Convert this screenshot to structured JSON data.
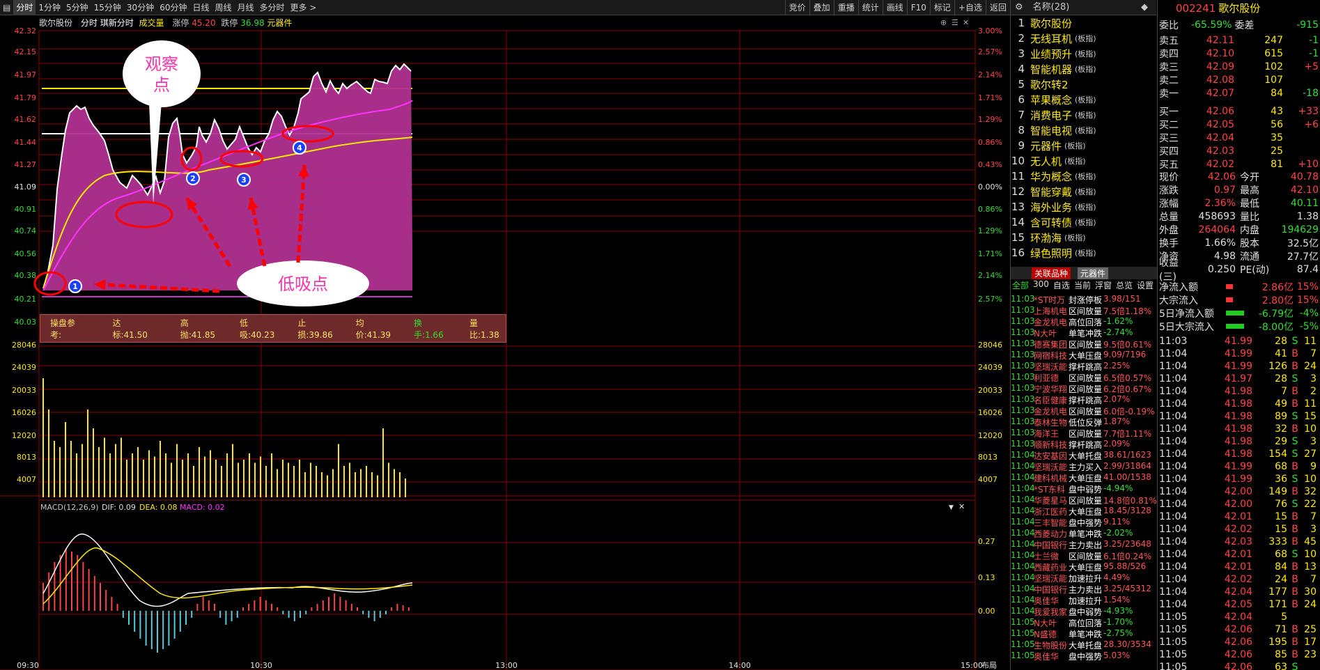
{
  "toolbar": {
    "tabs": [
      "分时",
      "1分钟",
      "5分钟",
      "15分钟",
      "30分钟",
      "60分钟",
      "日线",
      "周线",
      "月线",
      "多分时",
      "更多 >"
    ],
    "right": [
      "竞价",
      "叠加",
      "重播",
      "统计",
      "画线",
      "F10",
      "标记",
      "+自选",
      "返回"
    ]
  },
  "info": {
    "stock": "歌尔股份",
    "mode": "分时",
    "sub": "琪新分时",
    "vol": "成交量",
    "zt_label": "涨停",
    "zt": "45.20",
    "dt_label": "跌停",
    "dt": "36.98",
    "sector": "元器件"
  },
  "price_axis": [
    "42.32",
    "42.15",
    "41.97",
    "41.79",
    "41.62",
    "41.44",
    "41.27",
    "41.09",
    "40.91",
    "40.74",
    "40.56",
    "40.38",
    "40.21",
    "40.03"
  ],
  "pct_axis": [
    "3.00%",
    "2.57%",
    "2.14%",
    "1.71%",
    "1.29%",
    "0.86%",
    "0.43%",
    "0.00%",
    "0.86%",
    "1.29%",
    "1.71%",
    "2.14%",
    "2.57%"
  ],
  "vol_axis": [
    "28046",
    "24039",
    "20033",
    "16026",
    "12020",
    "8013",
    "4007"
  ],
  "macd": {
    "label": "MACD(12,26,9)",
    "dif": "DIF: 0.09",
    "dea": "DEA: 0.08",
    "macd": "MACD: 0.02",
    "axis": [
      "0.27",
      "0.13",
      "0.00"
    ]
  },
  "time_axis": [
    "09:30",
    "10:30",
    "13:00",
    "14:00",
    "15:00"
  ],
  "layout_btn": "布局",
  "annot": {
    "observe": "观察点",
    "buy": "低吸点",
    "n1": "1",
    "n2": "2",
    "n3": "3",
    "n4": "4"
  },
  "ops": {
    "title": "操盘参考:",
    "target": "达标:41.50",
    "high": "高抛:41.85",
    "low": "低吸:40.23",
    "stop": "止损:39.86",
    "avg": "均价:41.39",
    "turn": "换手:1.66",
    "ratio": "量比:1.38"
  },
  "blocks": {
    "header": "名称(28)",
    "items": [
      {
        "n": "1",
        "t": "歌尔股份",
        "s": ""
      },
      {
        "n": "2",
        "t": "无线耳机",
        "s": "(板指)"
      },
      {
        "n": "3",
        "t": "业绩预升",
        "s": "(板指)"
      },
      {
        "n": "4",
        "t": "智能机器",
        "s": "(板指)"
      },
      {
        "n": "5",
        "t": "歌尔转2",
        "s": ""
      },
      {
        "n": "6",
        "t": "苹果概念",
        "s": "(板指)"
      },
      {
        "n": "7",
        "t": "消费电子",
        "s": "(板指)"
      },
      {
        "n": "8",
        "t": "智能电视",
        "s": "(板指)"
      },
      {
        "n": "9",
        "t": "元器件",
        "s": "(板指)"
      },
      {
        "n": "10",
        "t": "无人机",
        "s": "(板指)"
      },
      {
        "n": "11",
        "t": "华为概念",
        "s": "(板指)"
      },
      {
        "n": "12",
        "t": "智能穿戴",
        "s": "(板指)"
      },
      {
        "n": "13",
        "t": "海外业务",
        "s": "(板指)"
      },
      {
        "n": "14",
        "t": "含可转债",
        "s": "(板指)"
      },
      {
        "n": "15",
        "t": "环渤海",
        "s": "(板指)"
      },
      {
        "n": "16",
        "t": "绿色照明",
        "s": "(板指)"
      }
    ],
    "tab1": "关联品种",
    "tab2": "元器件",
    "sub": [
      "全部",
      "300",
      "自选",
      "当前",
      "浮窗",
      "总览",
      "设置"
    ]
  },
  "alerts": [
    [
      "11:03",
      "*ST时万",
      "封涨停板",
      "3.98/151"
    ],
    [
      "11:03",
      "上海机电",
      "区间放量",
      "7.5倍1.18%"
    ],
    [
      "11:03",
      "金龙机电",
      "高位回落",
      "-1.62%"
    ],
    [
      "11:03",
      "N大叶",
      "单笔冲跌",
      "-2.74%"
    ],
    [
      "11:03",
      "德赛集团",
      "区间放量",
      "9.5倍0.61%"
    ],
    [
      "11:03",
      "网宿科技",
      "大单压盘",
      "9.09/7196"
    ],
    [
      "11:03",
      "坚瑞沃能",
      "撑杆跳高",
      "2.25%"
    ],
    [
      "11:03",
      "利亚德",
      "区间放量",
      "6.5倍0.57%"
    ],
    [
      "11:03",
      "宁波华翔",
      "区间放量",
      "6.2倍0.67%"
    ],
    [
      "11:03",
      "名臣健康",
      "撑杆跳高",
      "2.07%"
    ],
    [
      "11:03",
      "金龙机电",
      "区间放量",
      "6.0倍-0.19%"
    ],
    [
      "11:03",
      "泰林生物",
      "低位反弹",
      "1.87%"
    ],
    [
      "11:03",
      "海洋王",
      "区间放量",
      "7.7倍1.11%"
    ],
    [
      "11:03",
      "顺新科技",
      "撑杆跳高",
      "2.09%"
    ],
    [
      "11:04",
      "达安基因",
      "大单托盘",
      "38.61/1623"
    ],
    [
      "11:04",
      "坚瑞沃能",
      "主力买入",
      "2.99/31864"
    ],
    [
      "11:04",
      "建科机械",
      "大单压盘",
      "41.00/1538"
    ],
    [
      "11:04",
      "*ST东科",
      "盘中弱势",
      "-4.94%"
    ],
    [
      "11:04",
      "华菱星马",
      "区间放量",
      "14.8倍0.81%"
    ],
    [
      "11:04",
      "浙江医药",
      "大单压盘",
      "18.45/3128"
    ],
    [
      "11:04",
      "三丰智能",
      "盘中强势",
      "9.11%"
    ],
    [
      "11:04",
      "西菱动力",
      "单笔冲跌",
      "-2.02%"
    ],
    [
      "11:04",
      "中国银行",
      "主力卖出",
      "3.25/23648"
    ],
    [
      "11:04",
      "士兰微",
      "区间放量",
      "6.1倍0.24%"
    ],
    [
      "11:04",
      "西藏药业",
      "大单压盘",
      "95.88/526"
    ],
    [
      "11:04",
      "坚瑞沃能",
      "加速拉升",
      "4.49%"
    ],
    [
      "11:04",
      "中国银行",
      "主力卖出",
      "3.25/45312"
    ],
    [
      "11:04",
      "奥佳华",
      "加速拉升",
      "1.54%"
    ],
    [
      "11:04",
      "我爱我家",
      "盘中弱势",
      "-4.93%"
    ],
    [
      "11:05",
      "N大叶",
      "高位回落",
      "-1.70%"
    ],
    [
      "11:05",
      "N盛德",
      "单笔冲跌",
      "-2.75%"
    ],
    [
      "11:05",
      "生物股份",
      "大单托盘",
      "28.30/3534"
    ],
    [
      "11:05",
      "奥佳华",
      "盘中强势",
      "5.03%"
    ]
  ],
  "quote": {
    "code": "002241",
    "name": "歌尔股份",
    "webi_l": "委比",
    "webi": "-65.59%",
    "wecha_l": "委差",
    "wecha": "-915",
    "sell": [
      [
        "卖五",
        "42.11",
        "247",
        "-1"
      ],
      [
        "卖四",
        "42.10",
        "615",
        "-1"
      ],
      [
        "卖三",
        "42.09",
        "102",
        "+5"
      ],
      [
        "卖二",
        "42.08",
        "107",
        ""
      ],
      [
        "卖一",
        "42.07",
        "84",
        "-18"
      ]
    ],
    "buy": [
      [
        "买一",
        "42.06",
        "43",
        "+33"
      ],
      [
        "买二",
        "42.05",
        "56",
        "+6"
      ],
      [
        "买三",
        "42.04",
        "35",
        ""
      ],
      [
        "买四",
        "42.03",
        "25",
        ""
      ],
      [
        "买五",
        "42.02",
        "81",
        "+10"
      ]
    ],
    "stats": [
      [
        "现价",
        "42.06",
        "今开",
        "40.78"
      ],
      [
        "涨跌",
        "0.97",
        "最高",
        "42.10"
      ],
      [
        "涨幅",
        "2.36%",
        "最低",
        "40.11"
      ],
      [
        "总量",
        "458693",
        "量比",
        "1.38"
      ],
      [
        "外盘",
        "264064",
        "内盘",
        "194629"
      ],
      [
        "换手",
        "1.66%",
        "股本",
        "32.5亿"
      ],
      [
        "净资",
        "4.98",
        "流通",
        "27.7亿"
      ],
      [
        "收益(三)",
        "0.250",
        "PE(动)",
        "87.4"
      ]
    ],
    "flows": [
      [
        "净流入额",
        "2.86亿",
        "15%"
      ],
      [
        "大宗流入",
        "2.80亿",
        "15%"
      ],
      [
        "5日净流入额",
        "-6.79亿",
        "-4%"
      ],
      [
        "5日大宗流入",
        "-8.00亿",
        "-5%"
      ]
    ],
    "ticks": [
      [
        "11:03",
        "41.99",
        "28",
        "S",
        "11"
      ],
      [
        "11:04",
        "41.99",
        "41",
        "B",
        "7"
      ],
      [
        "11:04",
        "41.99",
        "126",
        "B",
        "24"
      ],
      [
        "11:04",
        "41.97",
        "28",
        "S",
        "3"
      ],
      [
        "11:04",
        "41.98",
        "7",
        "B",
        "2"
      ],
      [
        "11:04",
        "41.98",
        "49",
        "B",
        "11"
      ],
      [
        "11:04",
        "41.98",
        "89",
        "S",
        "15"
      ],
      [
        "11:04",
        "41.98",
        "32",
        "B",
        "10"
      ],
      [
        "11:04",
        "41.98",
        "29",
        "S",
        "3"
      ],
      [
        "11:04",
        "41.98",
        "154",
        "S",
        "27"
      ],
      [
        "11:04",
        "41.99",
        "68",
        "B",
        "9"
      ],
      [
        "11:04",
        "41.99",
        "36",
        "S",
        "10"
      ],
      [
        "11:04",
        "42.00",
        "149",
        "B",
        "32"
      ],
      [
        "11:04",
        "42.00",
        "76",
        "S",
        "22"
      ],
      [
        "11:04",
        "42.01",
        "15",
        "B",
        "7"
      ],
      [
        "11:04",
        "42.02",
        "15",
        "B",
        "3"
      ],
      [
        "11:04",
        "42.03",
        "333",
        "B",
        "45"
      ],
      [
        "11:04",
        "42.01",
        "68",
        "S",
        "10"
      ],
      [
        "11:04",
        "42.01",
        "84",
        "B",
        "13"
      ],
      [
        "11:04",
        "42.02",
        "24",
        "B",
        "7"
      ],
      [
        "11:04",
        "42.04",
        "177",
        "B",
        "30"
      ],
      [
        "11:04",
        "42.05",
        "171",
        "B",
        "24"
      ],
      [
        "11:05",
        "42.04",
        "5",
        "",
        ""
      ],
      [
        "11:05",
        "42.06",
        "71",
        "B",
        "25"
      ],
      [
        "11:05",
        "42.06",
        "195",
        "B",
        "17"
      ],
      [
        "11:05",
        "42.06",
        "85",
        "B",
        "23"
      ],
      [
        "11:05",
        "42.06",
        "63",
        "S",
        ""
      ]
    ]
  }
}
